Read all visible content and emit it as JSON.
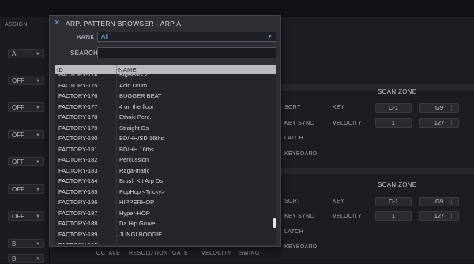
{
  "background": {
    "assign_label": "ASSIGN",
    "left_selects": [
      "A",
      "OFF",
      "OFF",
      "OFF",
      "OFF",
      "OFF",
      "OFF",
      "B",
      "B"
    ],
    "scan_zone_title": "SCAN ZONE",
    "panel1": {
      "sort": "SORT",
      "key_sync": "KEY SYNC",
      "latch": "LATCH",
      "keyboard": "KEYBOARD",
      "key": "KEY",
      "velocity": "VELOCITY",
      "key_low": "C-1",
      "key_high": "G9",
      "vel_low": "1",
      "vel_high": "127"
    },
    "panel2": {
      "sort": "SORT",
      "key_sync": "KEY SYNC",
      "latch": "LATCH",
      "keyboard": "KEYBOARD",
      "key": "KEY",
      "velocity": "VELOCITY",
      "key_low": "C-1",
      "key_high": "G9",
      "vel_low": "1",
      "vel_high": "127"
    },
    "bottom_labels": [
      "OCTAVE",
      "RESOLUTION",
      "GATE",
      "VELOCITY",
      "SWING"
    ]
  },
  "dialog": {
    "close_icon": "close-icon",
    "title": "ARP. PATTERN BROWSER - ARP A",
    "bank_label": "BANK",
    "bank_value": "All",
    "search_label": "SEARCH",
    "search_value": "",
    "columns": {
      "id": "ID",
      "name": "NAME"
    },
    "rows": [
      {
        "id": "FACTORY-174",
        "name": "BigBeats 2"
      },
      {
        "id": "FACTORY-175",
        "name": "Acid Drum"
      },
      {
        "id": "FACTORY-176",
        "name": "BUGGER BEAT"
      },
      {
        "id": "FACTORY-177",
        "name": "4 on the floor"
      },
      {
        "id": "FACTORY-178",
        "name": "Ethnic Perc."
      },
      {
        "id": "FACTORY-179",
        "name": "Straight Ds"
      },
      {
        "id": "FACTORY-180",
        "name": "BD/HH/SD 16ths"
      },
      {
        "id": "FACTORY-181",
        "name": "BD/HH 16ths"
      },
      {
        "id": "FACTORY-182",
        "name": "Percussion"
      },
      {
        "id": "FACTORY-183",
        "name": "Raga-matic"
      },
      {
        "id": "FACTORY-184",
        "name": "Brush Kit Arp Ds"
      },
      {
        "id": "FACTORY-185",
        "name": "PopHop  <Tricky>"
      },
      {
        "id": "FACTORY-186",
        "name": "HIPPERHOP"
      },
      {
        "id": "FACTORY-187",
        "name": "Hyper-HOP"
      },
      {
        "id": "FACTORY-188",
        "name": "Da Hip Gruve"
      },
      {
        "id": "FACTORY-189",
        "name": "JUNGLBOOGIE"
      },
      {
        "id": "FACTORY-190",
        "name": ""
      }
    ]
  },
  "colors": {
    "accent": "#6da6f0",
    "dialog_bg": "#2e2f34",
    "header_bg": "#b9bbc1"
  }
}
